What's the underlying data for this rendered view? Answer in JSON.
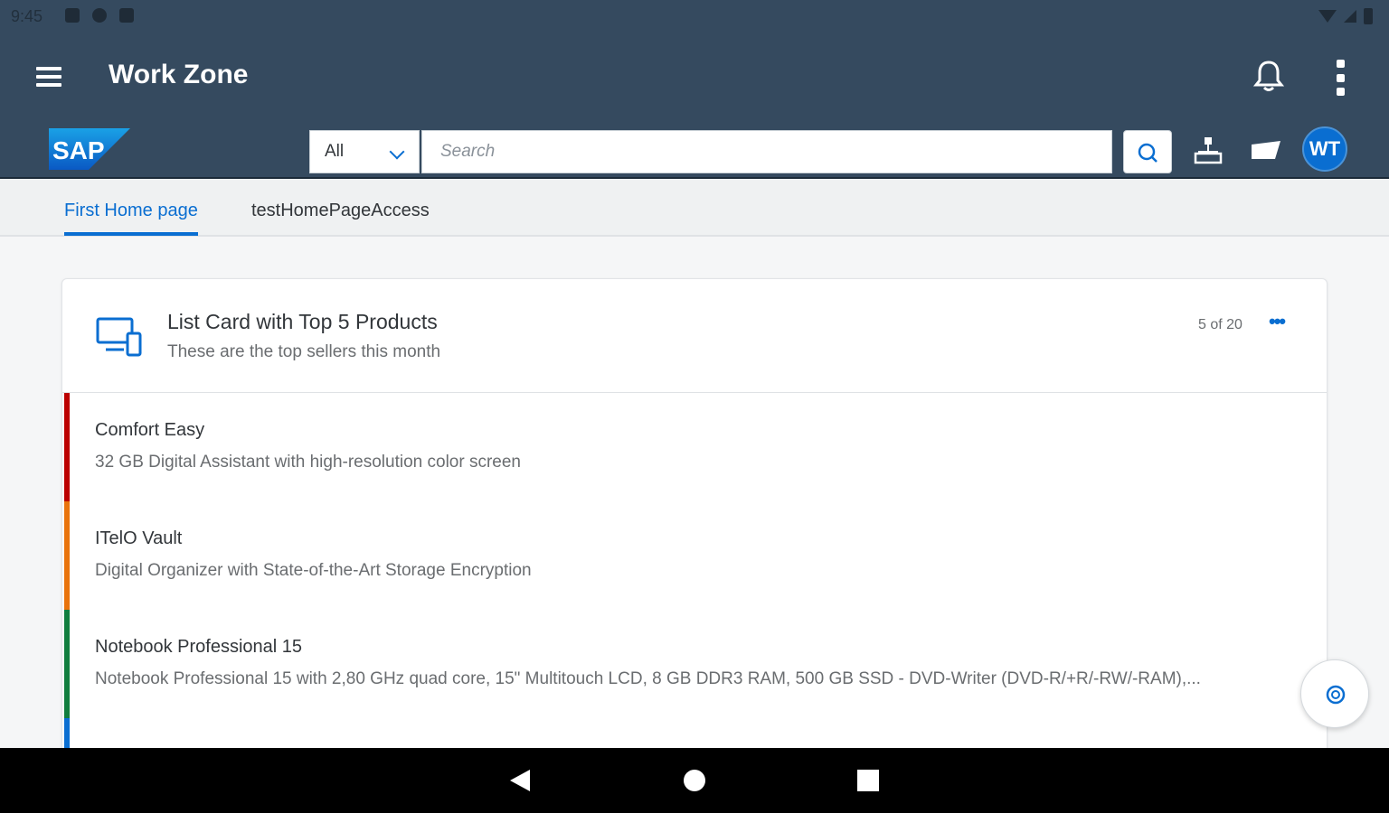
{
  "status_bar": {
    "time": "9:45"
  },
  "app_bar": {
    "title": "Work Zone"
  },
  "shell": {
    "logo_text": "SAP",
    "search_scope": "All",
    "search_placeholder": "Search",
    "avatar_initials": "WT"
  },
  "tabs": [
    {
      "label": "First Home page",
      "active": true
    },
    {
      "label": "testHomePageAccess",
      "active": false
    }
  ],
  "card": {
    "title": "List Card with Top 5 Products",
    "subtitle": "These are the top sellers this month",
    "count": "5 of 20",
    "menu": "•••",
    "items": [
      {
        "title": "Comfort Easy",
        "description": "32 GB Digital Assistant with high-resolution color screen",
        "color": "#bb0000"
      },
      {
        "title": "ITelO Vault",
        "description": "Digital Organizer with State-of-the-Art Storage Encryption",
        "color": "#e9730c"
      },
      {
        "title": "Notebook Professional 15",
        "description": "Notebook Professional 15 with 2,80 GHz quad core, 15\" Multitouch LCD, 8 GB DDR3 RAM, 500 GB SSD - DVD-Writer (DVD-R/+R/-RW/-RAM),...",
        "color": "#107e3e"
      },
      {
        "color": "#0a6ed1"
      }
    ]
  },
  "colors": {
    "shell": "#354a5f",
    "accent": "#0a6ed1",
    "negative": "#bb0000",
    "critical": "#e9730c",
    "positive": "#107e3e"
  }
}
